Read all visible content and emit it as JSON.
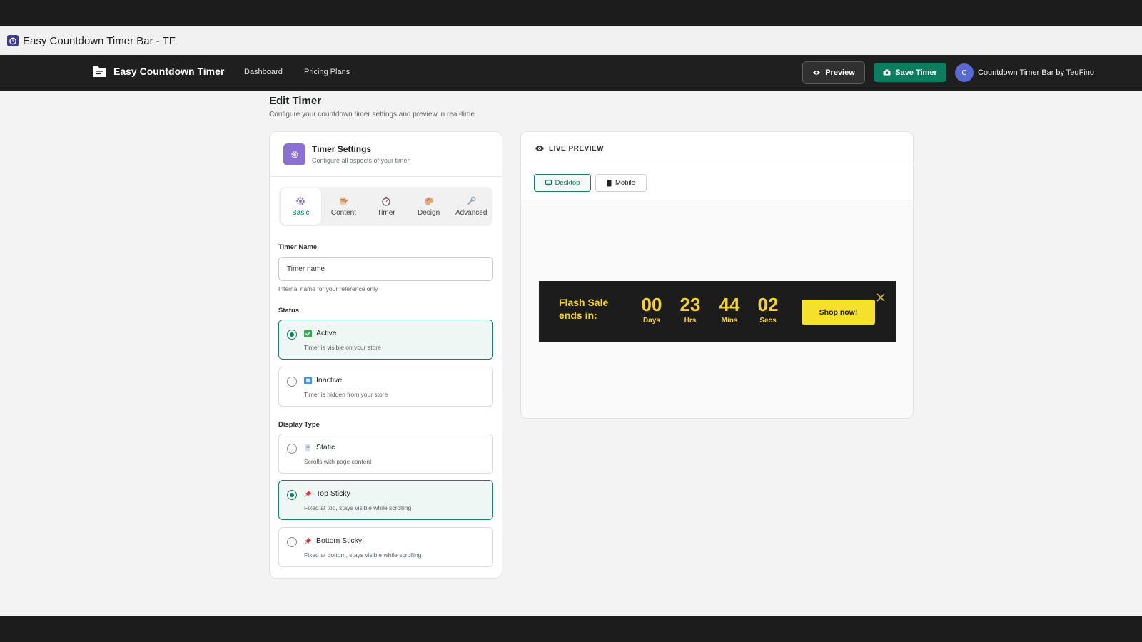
{
  "window": {
    "title": "Easy Countdown Timer Bar - TF"
  },
  "nav": {
    "brand": "Easy Countdown Timer",
    "links": [
      "Dashboard",
      "Pricing Plans"
    ],
    "preview_label": "Preview",
    "save_label": "Save Timer",
    "avatar_initial": "C",
    "account_name": "Countdown Timer Bar by TeqFino"
  },
  "page": {
    "title": "Edit Timer",
    "subtitle": "Configure your countdown timer settings and preview in real-time"
  },
  "settings": {
    "title": "Timer Settings",
    "subtitle": "Configure all aspects of your timer",
    "tabs": [
      "Basic",
      "Content",
      "Timer",
      "Design",
      "Advanced"
    ],
    "active_tab": "Basic",
    "timer_name_label": "Timer Name",
    "timer_name_value": "Timer name",
    "timer_name_hint": "Internal name for your reference only",
    "status_label": "Status",
    "status_options": [
      {
        "title": "Active",
        "desc": "Timer is visible on your store",
        "selected": true
      },
      {
        "title": "Inactive",
        "desc": "Timer is hidden from your store",
        "selected": false
      }
    ],
    "display_label": "Display Type",
    "display_options": [
      {
        "title": "Static",
        "desc": "Scrolls with page content",
        "selected": false
      },
      {
        "title": "Top Sticky",
        "desc": "Fixed at top, stays visible while scrolling",
        "selected": true
      },
      {
        "title": "Bottom Sticky",
        "desc": "Fixed at bottom, stays visible while scrolling",
        "selected": false
      }
    ]
  },
  "preview": {
    "title": "LIVE PREVIEW",
    "devices": [
      "Desktop",
      "Mobile"
    ],
    "active_device": "Desktop",
    "bar": {
      "headline_line1": "Flash Sale",
      "headline_line2": "ends in:",
      "units": [
        {
          "value": "00",
          "label": "Days"
        },
        {
          "value": "23",
          "label": "Hrs"
        },
        {
          "value": "44",
          "label": "Mins"
        },
        {
          "value": "02",
          "label": "Secs"
        }
      ],
      "button": "Shop now!",
      "bg_color": "#1c1c1c",
      "text_color": "#f5d423",
      "button_color": "#f5e12b"
    }
  },
  "colors": {
    "accent": "#0c7d5f",
    "nav_bg": "#1f1f1f",
    "page_bg": "#f3f3f3"
  }
}
